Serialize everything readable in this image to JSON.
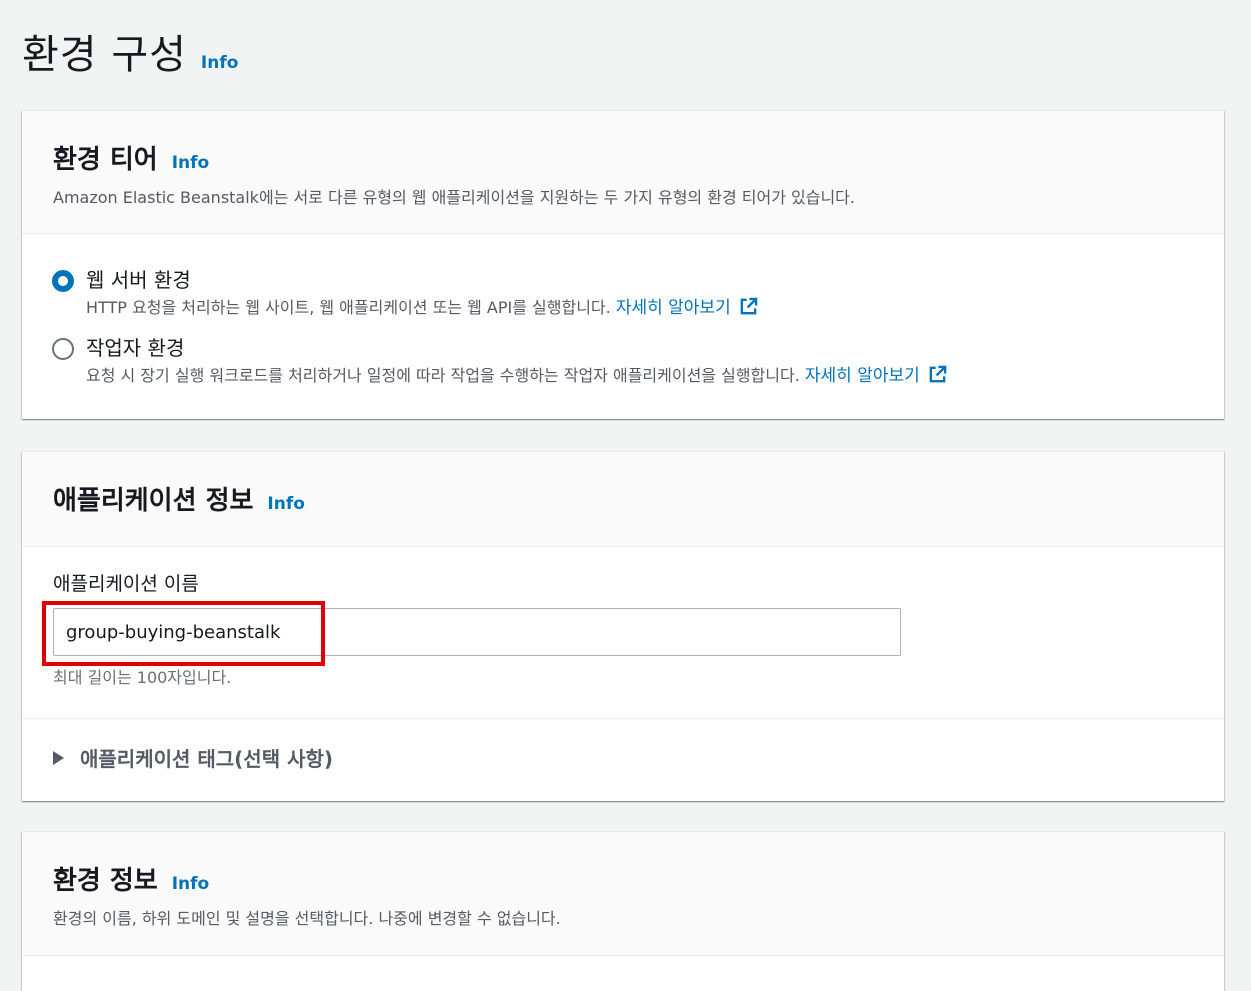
{
  "page": {
    "title": "환경 구성",
    "info": "Info"
  },
  "tier_panel": {
    "title": "환경 티어",
    "info": "Info",
    "description": "Amazon Elastic Beanstalk에는 서로 다른 유형의 웹 애플리케이션을 지원하는 두 가지 유형의 환경 티어가 있습니다.",
    "options": [
      {
        "label": "웹 서버 환경",
        "description": "HTTP 요청을 처리하는 웹 사이트, 웹 애플리케이션 또는 웹 API를 실행합니다. ",
        "link": "자세히 알아보기",
        "selected": true
      },
      {
        "label": "작업자 환경",
        "description": "요청 시 장기 실행 워크로드를 처리하거나 일정에 따라 작업을 수행하는 작업자 애플리케이션을 실행합니다. ",
        "link": "자세히 알아보기",
        "selected": false
      }
    ]
  },
  "app_panel": {
    "title": "애플리케이션 정보",
    "info": "Info",
    "field_label": "애플리케이션 이름",
    "field_value": "group-buying-beanstalk",
    "field_hint": "최대 길이는 100자입니다.",
    "tags_label": "애플리케이션 태그(선택 사항)"
  },
  "env_panel": {
    "title": "환경 정보",
    "info": "Info",
    "description": "환경의 이름, 하위 도메인 및 설명을 선택합니다. 나중에 변경할 수 없습니다."
  },
  "colors": {
    "link": "#0073bb",
    "highlight": "#e00000",
    "background": "#f2f3f3"
  },
  "icons": {
    "external_link": "external-link-icon",
    "expand": "caret-right-icon"
  }
}
